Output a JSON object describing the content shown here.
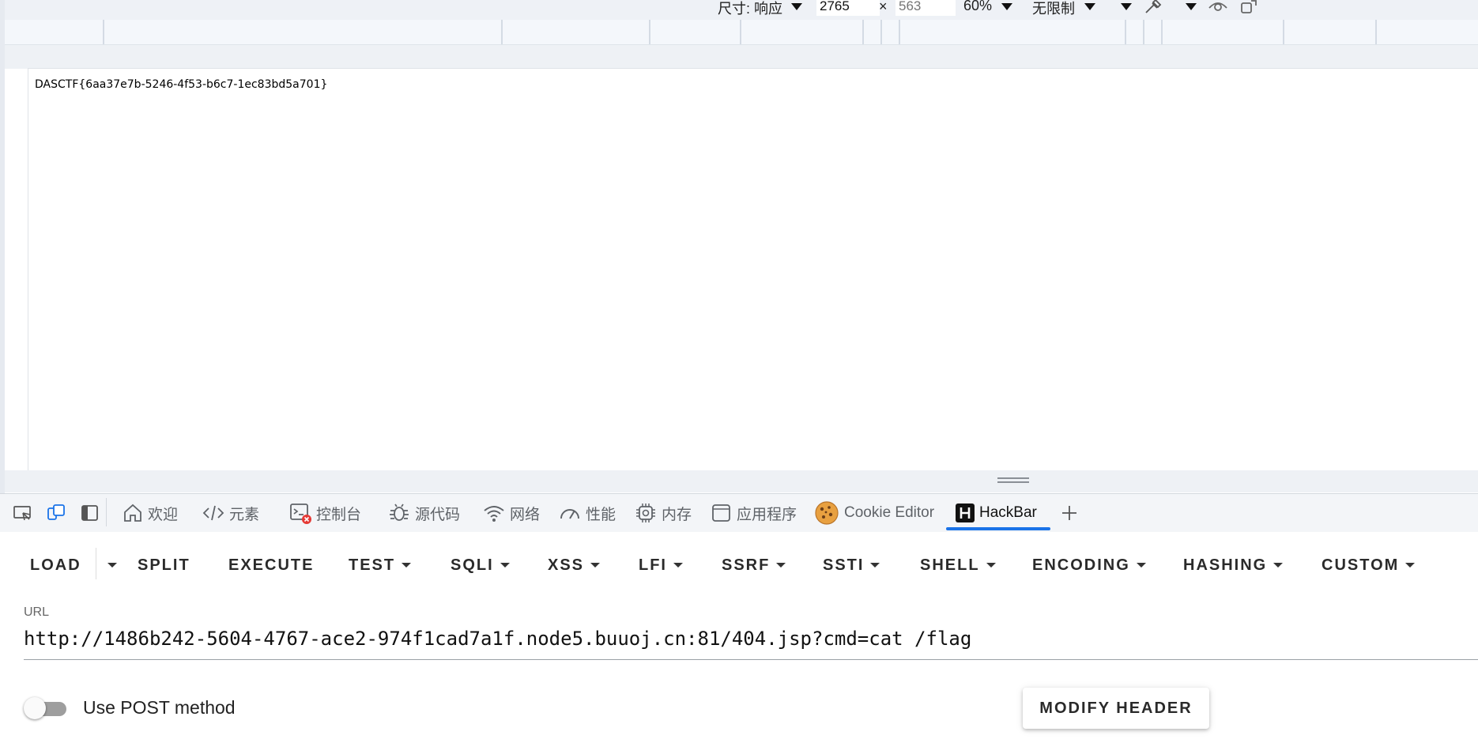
{
  "toolbar": {
    "size_label": "尺寸: 响应",
    "width_value": "2765",
    "height_placeholder": "563",
    "times_sign": "×",
    "zoom": "60%",
    "throttle": "无限制"
  },
  "page": {
    "content_text": "DASCTF{6aa37e7b-5246-4f53-b6c7-1ec83bd5a701}"
  },
  "devtools": {
    "tabs": [
      {
        "label": "欢迎",
        "icon": "home-icon"
      },
      {
        "label": "元素",
        "icon": "code-icon"
      },
      {
        "label": "控制台",
        "icon": "console-icon"
      },
      {
        "label": "源代码",
        "icon": "bug-icon"
      },
      {
        "label": "网络",
        "icon": "wifi-icon"
      },
      {
        "label": "性能",
        "icon": "gauge-icon"
      },
      {
        "label": "内存",
        "icon": "chip-icon"
      },
      {
        "label": "应用程序",
        "icon": "app-window-icon"
      },
      {
        "label": "Cookie Editor",
        "icon": "cookie-icon"
      },
      {
        "label": "HackBar",
        "icon": "hackbar-icon"
      }
    ],
    "active_tab": "HackBar",
    "add_tab": "+"
  },
  "hackbar": {
    "buttons": {
      "load": "LOAD",
      "split": "SPLIT",
      "execute": "EXECUTE",
      "test": "TEST",
      "sqli": "SQLI",
      "xss": "XSS",
      "lfi": "LFI",
      "ssrf": "SSRF",
      "ssti": "SSTI",
      "shell": "SHELL",
      "encoding": "ENCODING",
      "hashing": "HASHING",
      "custom": "CUSTOM"
    },
    "url_label": "URL",
    "url_value": "http://1486b242-5604-4767-ace2-974f1cad7a1f.node5.buuoj.cn:81/404.jsp?cmd=cat /flag",
    "post_label": "Use POST method",
    "post_enabled": false,
    "modify_header": "MODIFY HEADER"
  },
  "colors": {
    "accent": "#1a73e8",
    "console_error_badge": "#e53935"
  }
}
